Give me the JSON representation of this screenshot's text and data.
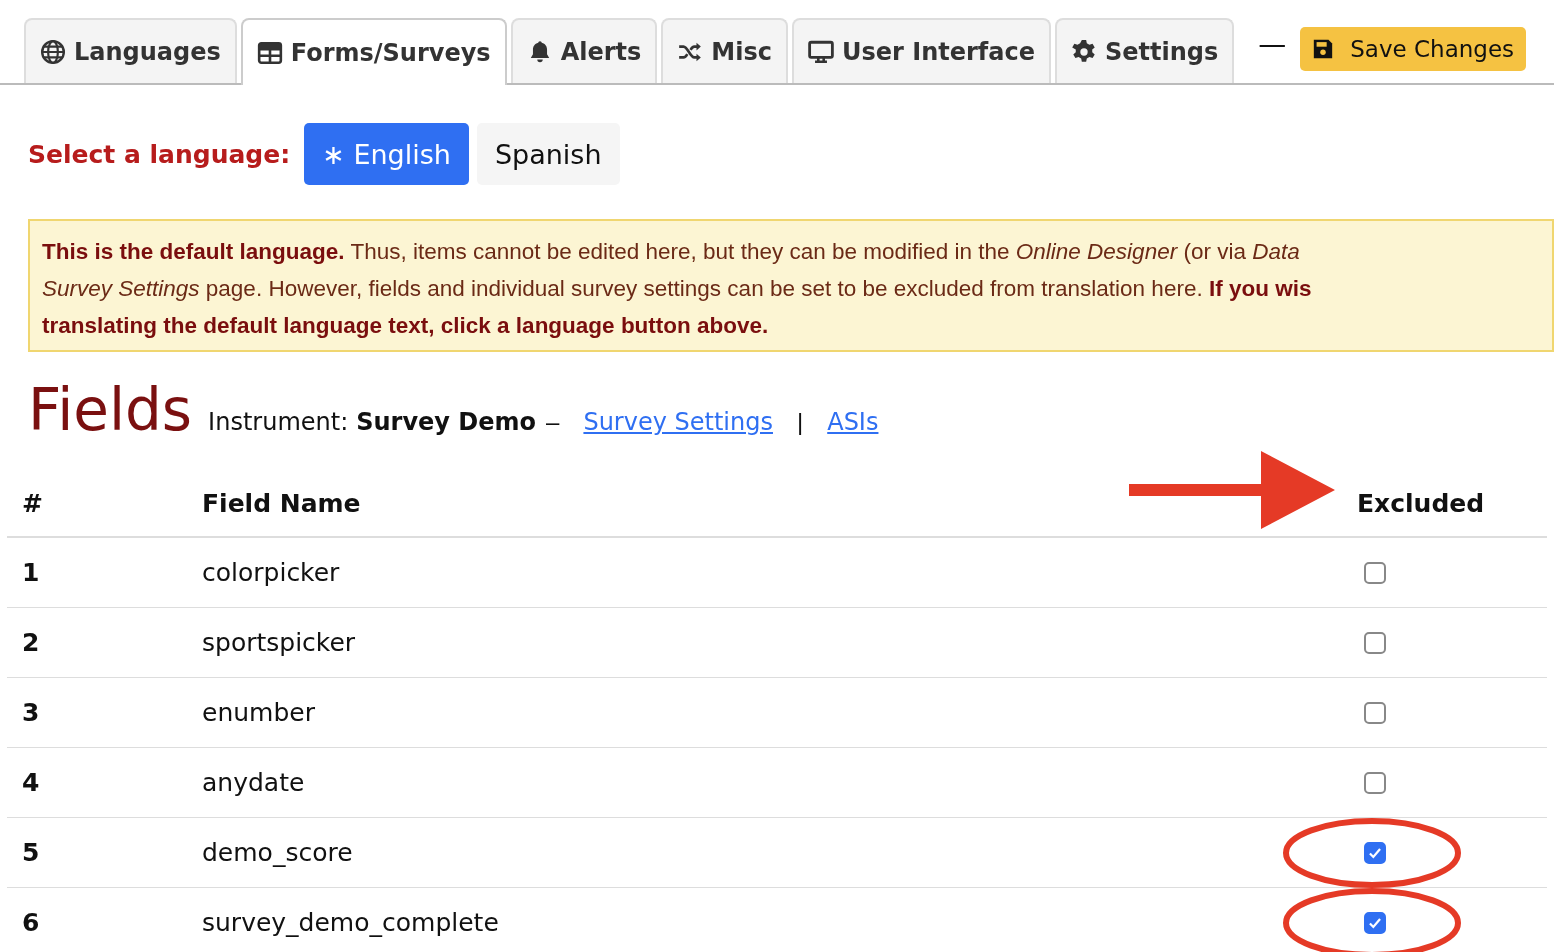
{
  "tabs": [
    {
      "label": "Languages",
      "selected": false
    },
    {
      "label": "Forms/Surveys",
      "selected": true
    },
    {
      "label": "Alerts",
      "selected": false
    },
    {
      "label": "Misc",
      "selected": false
    },
    {
      "label": "User Interface",
      "selected": false
    },
    {
      "label": "Settings",
      "selected": false
    }
  ],
  "separator": "—",
  "save_button": "Save Changes",
  "language_select": {
    "label": "Select a language:",
    "languages": [
      {
        "label": "English",
        "marker": "∗",
        "selected": true
      },
      {
        "label": "Spanish",
        "selected": false
      }
    ]
  },
  "notice": {
    "lines": [
      "**This is the default language.** Thus, items cannot be edited here, but they can be modified in the *Online Designer* (or via *Data*",
      "*Survey Settings* page. However, fields and individual survey settings can be set to be excluded from translation here. **If you wis**",
      "**translating the default language text, click a language button above.**"
    ]
  },
  "fields": {
    "title": "Fields",
    "instrument_label": "Instrument:",
    "instrument": "Survey Demo",
    "dash": "–",
    "links": [
      "Survey Settings",
      "ASIs"
    ],
    "link_separator": "|"
  },
  "table": {
    "columns": [
      "#",
      "Field Name",
      "Excluded"
    ],
    "rows": [
      {
        "number": "1",
        "field_name": "colorpicker",
        "excluded": false
      },
      {
        "number": "2",
        "field_name": "sportspicker",
        "excluded": false
      },
      {
        "number": "3",
        "field_name": "enumber",
        "excluded": false
      },
      {
        "number": "4",
        "field_name": "anydate",
        "excluded": false
      },
      {
        "number": "5",
        "field_name": "demo_score",
        "excluded": true
      },
      {
        "number": "6",
        "field_name": "survey_demo_complete",
        "excluded": true
      }
    ]
  }
}
